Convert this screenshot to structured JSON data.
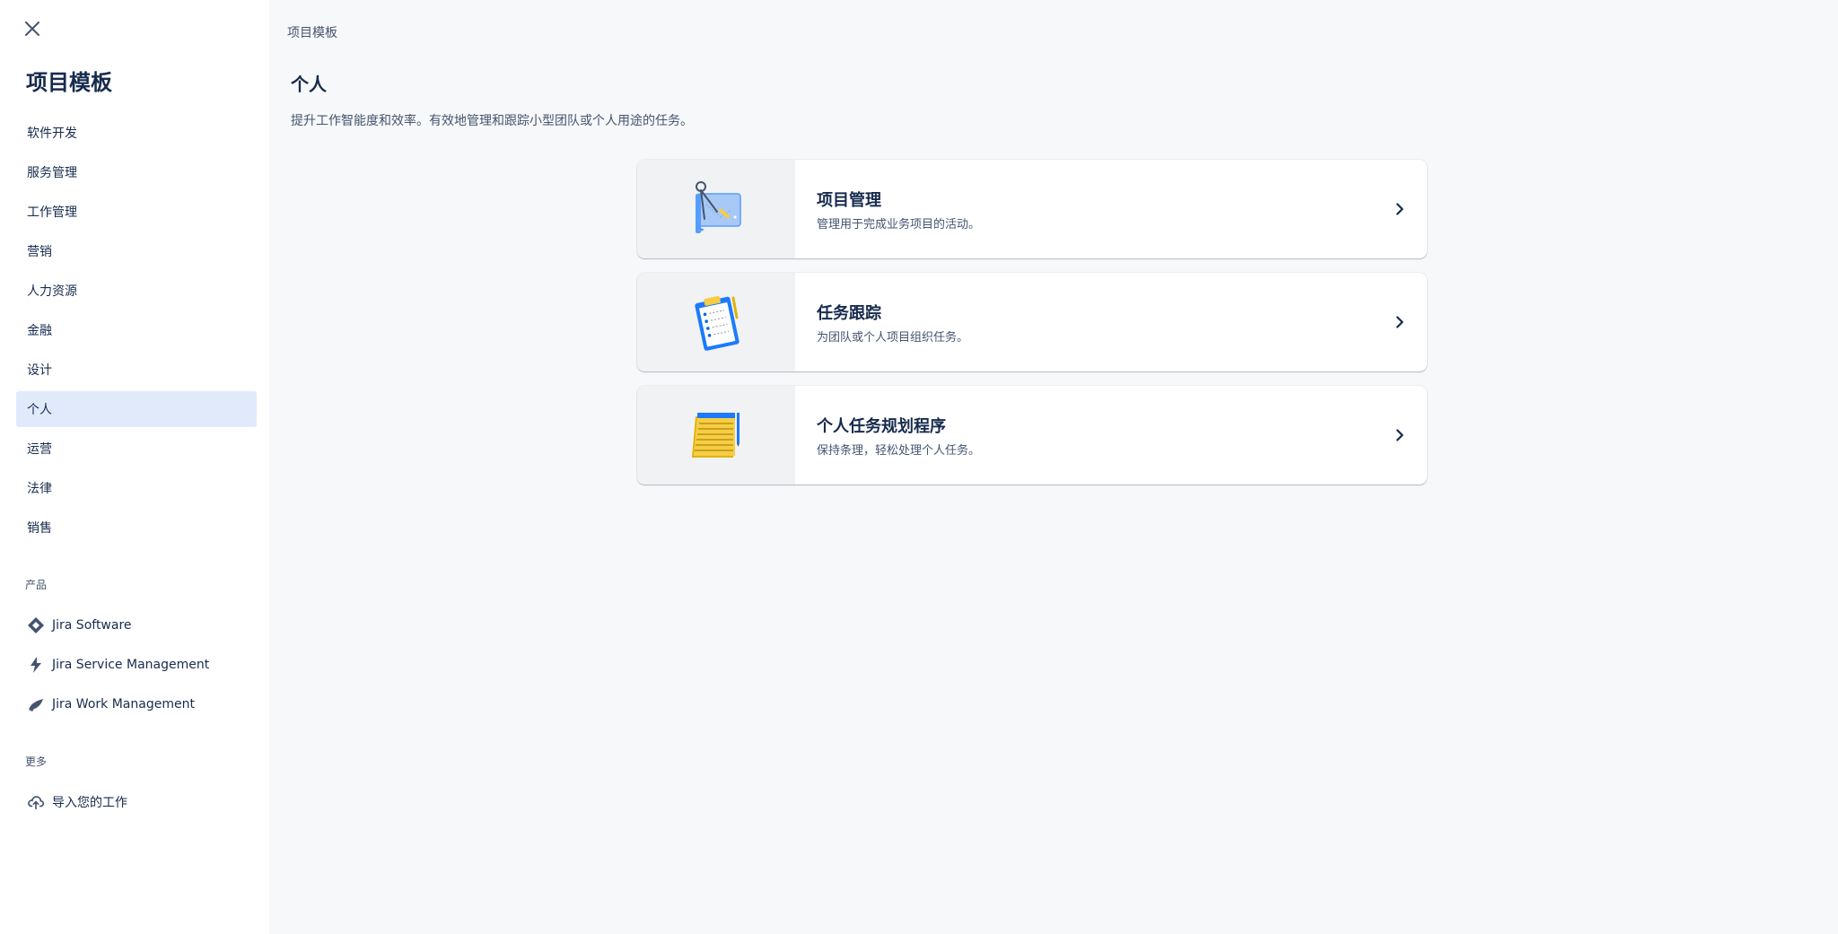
{
  "sidebar": {
    "title": "项目模板",
    "categories": [
      {
        "label": "软件开发"
      },
      {
        "label": "服务管理"
      },
      {
        "label": "工作管理"
      },
      {
        "label": "营销"
      },
      {
        "label": "人力资源"
      },
      {
        "label": "金融"
      },
      {
        "label": "设计"
      },
      {
        "label": "个人",
        "active": true
      },
      {
        "label": "运营"
      },
      {
        "label": "法律"
      },
      {
        "label": "销售"
      }
    ],
    "products_heading": "产品",
    "products": [
      {
        "label": "Jira Software",
        "icon": "jira-software-icon"
      },
      {
        "label": "Jira Service Management",
        "icon": "jira-service-management-icon"
      },
      {
        "label": "Jira Work Management",
        "icon": "jira-work-management-icon"
      }
    ],
    "more_heading": "更多",
    "more_items": [
      {
        "label": "导入您的工作",
        "icon": "cloud-upload-icon"
      }
    ]
  },
  "main": {
    "breadcrumb": "项目模板",
    "title": "个人",
    "description": "提升工作智能度和效率。有效地管理和跟踪小型团队或个人用途的任务。",
    "cards": [
      {
        "title": "项目管理",
        "description": "管理用于完成业务项目的活动。",
        "icon": "blueprint-icon"
      },
      {
        "title": "任务跟踪",
        "description": "为团队或个人项目组织任务。",
        "icon": "clipboard-icon"
      },
      {
        "title": "个人任务规划程序",
        "description": "保持条理，轻松处理个人任务。",
        "icon": "notepad-icon"
      }
    ]
  },
  "colors": {
    "active_bg": "#E0EAFB",
    "text_primary": "#172B4D",
    "text_subtle": "#44546F",
    "main_bg": "#F7F8F9",
    "media_bg": "#F1F2F4"
  }
}
